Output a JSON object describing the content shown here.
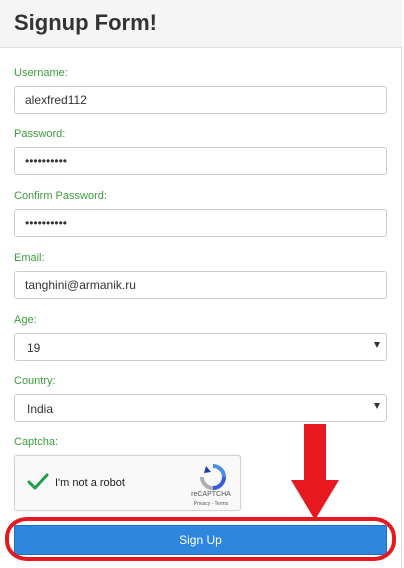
{
  "header": {
    "title": "Signup Form!"
  },
  "form": {
    "username": {
      "label": "Username:",
      "value": "alexfred112"
    },
    "password": {
      "label": "Password:",
      "value": "••••••••••"
    },
    "confirm_password": {
      "label": "Confirm Password:",
      "value": "••••••••••"
    },
    "email": {
      "label": "Email:",
      "value": "tanghini@armanik.ru"
    },
    "age": {
      "label": "Age:",
      "selected": "19"
    },
    "country": {
      "label": "Country:",
      "selected": "India"
    },
    "captcha": {
      "label": "Captcha:",
      "checkbox_label": "I'm not a robot",
      "brand": "reCAPTCHA",
      "links": "Privacy - Terms",
      "checked": true
    },
    "submit_label": "Sign Up"
  },
  "annotation": {
    "color": "#e8191e"
  },
  "colors": {
    "label_green": "#3c9d3c",
    "button_blue": "#2e86de"
  }
}
